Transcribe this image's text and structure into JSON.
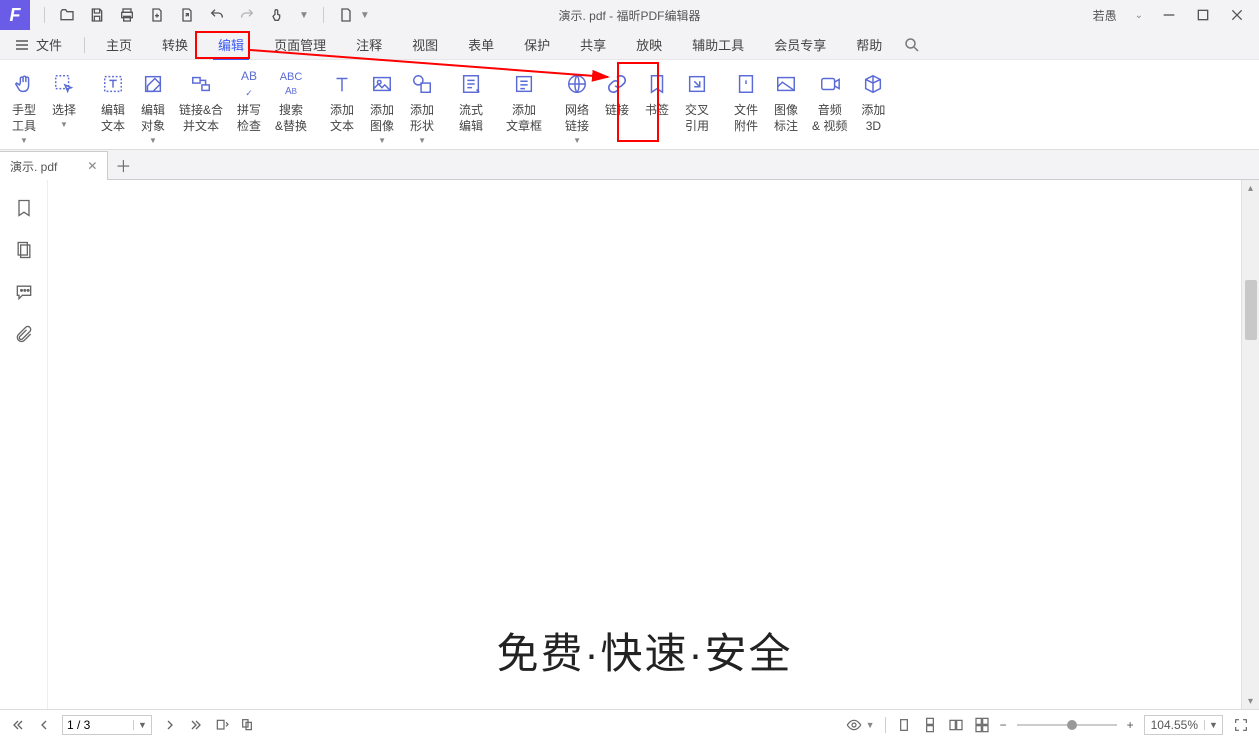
{
  "titlebar": {
    "doc_title": "演示. pdf",
    "app_title": "福昕PDF编辑器",
    "user": "若愚"
  },
  "menu": {
    "file": "文件",
    "items": [
      "主页",
      "转换",
      "编辑",
      "页面管理",
      "注释",
      "视图",
      "表单",
      "保护",
      "共享",
      "放映",
      "辅助工具",
      "会员专享",
      "帮助"
    ],
    "active_index": 2
  },
  "ribbon": {
    "hand": {
      "l1": "手型",
      "l2": "工具"
    },
    "select": {
      "l1": "选择"
    },
    "edit_text": {
      "l1": "编辑",
      "l2": "文本"
    },
    "edit_obj": {
      "l1": "编辑",
      "l2": "对象"
    },
    "link_merge": {
      "l1": "链接&合",
      "l2": "并文本"
    },
    "spell": {
      "l1": "拼写",
      "l2": "检查"
    },
    "search_replace": {
      "l1": "搜索",
      "l2": "&替换"
    },
    "add_text": {
      "l1": "添加",
      "l2": "文本"
    },
    "add_image": {
      "l1": "添加",
      "l2": "图像"
    },
    "add_shape": {
      "l1": "添加",
      "l2": "形状"
    },
    "flow_edit": {
      "l1": "流式",
      "l2": "编辑"
    },
    "add_article": {
      "l1": "添加",
      "l2": "文章框"
    },
    "web_link": {
      "l1": "网络",
      "l2": "链接"
    },
    "link": {
      "l1": "链接"
    },
    "bookmark": {
      "l1": "书签"
    },
    "cross_ref": {
      "l1": "交叉",
      "l2": "引用"
    },
    "file_attach": {
      "l1": "文件",
      "l2": "附件"
    },
    "image_annot": {
      "l1": "图像",
      "l2": "标注"
    },
    "audio_video": {
      "l1": "音频",
      "l2": "& 视频"
    },
    "add_3d": {
      "l1": "添加",
      "l2": "3D"
    }
  },
  "tab": {
    "name": "演示. pdf"
  },
  "document": {
    "headline": "免费·快速·安全"
  },
  "status": {
    "page": "1 / 3",
    "zoom": "104.55%"
  }
}
